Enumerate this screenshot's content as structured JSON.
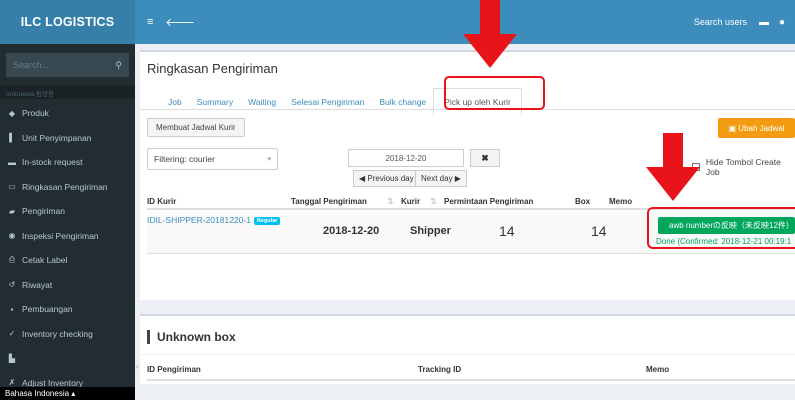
{
  "app": {
    "brand": "ILC LOGISTICS"
  },
  "topbar": {
    "search_users": "Search users"
  },
  "sidebar": {
    "search_placeholder": "Search...",
    "lang_strip": "Indonesia 팀장용",
    "items": [
      {
        "icon": "cube-icon",
        "label": "Produk"
      },
      {
        "icon": "building-icon",
        "label": "Unit Penyimpanan"
      },
      {
        "icon": "list-icon",
        "label": "In-stock request"
      },
      {
        "icon": "calendar-icon",
        "label": "Ringkasan Pengiriman"
      },
      {
        "icon": "truck-icon",
        "label": "Pengiriman"
      },
      {
        "icon": "eye-icon",
        "label": "Inspeksi Pengiriman"
      },
      {
        "icon": "print-icon",
        "label": "Cetak Label"
      },
      {
        "icon": "history-icon",
        "label": "Riwayat"
      },
      {
        "icon": "trash-icon",
        "label": "Pembuangan"
      },
      {
        "icon": "check-icon",
        "label": "Inventory checking"
      },
      {
        "icon": "chart-icon",
        "label": ""
      },
      {
        "icon": "wrench-icon",
        "label": "Adjust Inventory"
      }
    ],
    "language": "Bahasa Indonesia"
  },
  "main": {
    "title": "Ringkasan Pengiriman",
    "tabs": [
      "Job",
      "Summary",
      "Waiting",
      "Selesai Pengiriman",
      "Bulk change",
      "Pick up oleh Kurir"
    ],
    "schedule_button": "Membuat Jadwal Kurir",
    "edit_schedule_button": "Ubah Jadwal",
    "filter": "Filtering: courier",
    "date": "2018-12-20",
    "clear": "✖",
    "prev_day": "Previous day",
    "next_day": "Next day",
    "hide_create_job": "Hide Tombol Create Job",
    "table": {
      "headers": [
        "ID Kurir",
        "Tanggal Pengiriman",
        "Kurir",
        "Permintaan Pengiriman",
        "Box",
        "Memo"
      ],
      "rows": [
        {
          "id": "IDIL-SHIPPER-20181220-1",
          "badge": "Regular",
          "date": "2018-12-20",
          "kurir": "Shipper",
          "requests": "14",
          "box": "14",
          "awb_button": "awb numberの反映（未反映12件）",
          "done": "Done (Confirmed: 2018-12-21 00:19:1"
        }
      ]
    }
  },
  "unknown_box": {
    "title": "Unknown box",
    "headers": [
      "ID Pengiriman",
      "Tracking ID",
      "Memo"
    ]
  },
  "colors": {
    "topbar": "#3c8dbc",
    "sidebar": "#222d32",
    "annotation_red": "#e8141a",
    "success": "#00a65a",
    "warning": "#f39c12"
  }
}
